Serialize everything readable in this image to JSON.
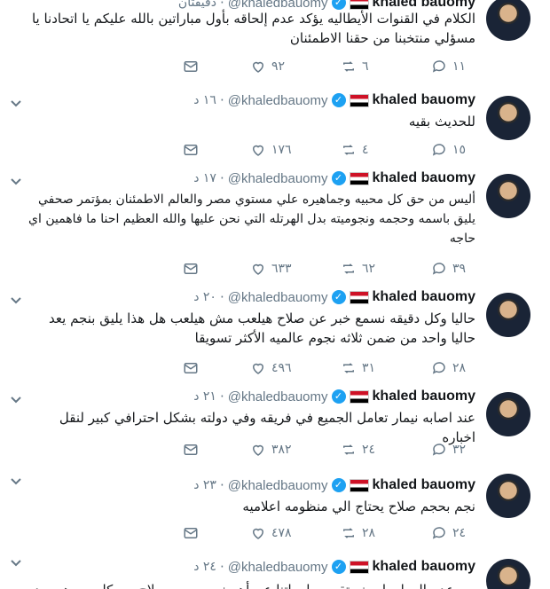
{
  "user": {
    "name": "khaled bauomy",
    "handle": "@khaledbauomy"
  },
  "tweets": [
    {
      "time": "دقيقتان",
      "text": "الكلام في القنوات الأيطاليه يؤكد عدم إلحاقه بأول مباراتين بالله عليكم يا اتحادنا يا مسؤلي منتخبنا من حقنا الاطمئنان",
      "replies": "١١",
      "retweets": "٦",
      "likes": "٩٢"
    },
    {
      "time": "١٦ د",
      "text": "للحديث بقيه",
      "replies": "١٥",
      "retweets": "٤",
      "likes": "١٧٦"
    },
    {
      "time": "١٧ د",
      "text": "أليس من حق كل محبيه وجماهيره علي مستوي مصر والعالم الاطمئنان بمؤتمر صحفي يليق باسمه وحجمه ونجوميته بدل الهرتله التي نحن عليها والله العظيم احنا ما فاهمين اي حاجه",
      "replies": "٣٩",
      "retweets": "٦٢",
      "likes": "٦٣٣"
    },
    {
      "time": "٢٠ د",
      "text": "حاليا وكل دقيقه نسمع خبر عن صلاح هيلعب مش هيلعب هل هذا يليق بنجم يعد حاليا واحد من ضمن ثلاثه نجوم عالميه الأكثر تسويقا",
      "replies": "٢٨",
      "retweets": "٣١",
      "likes": "٤٩٦"
    },
    {
      "time": "٢١ د",
      "text": "عند اصابه نيمار تعامل الجميع في فريقه وفي دولته بشكل احترافي كبير لنقل اخباره",
      "replies": "٣٢",
      "retweets": "٢٤",
      "likes": "٣٨٢"
    },
    {
      "time": "٢٣ د",
      "text": "نجم بحجم صلاح يحتاج الي منظومه اعلاميه",
      "replies": "٢٤",
      "retweets": "٢٨",
      "likes": "٤٧٨"
    },
    {
      "time": "٢٤ د",
      "text": "من عدم المعلومات نستقي معلوماتنا عن أهم نجم بحجم صلاح من كل من هب ودب",
      "replies": "",
      "retweets": "",
      "likes": ""
    }
  ]
}
